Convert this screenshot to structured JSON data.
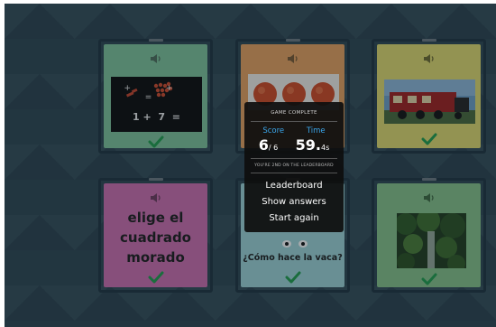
{
  "modal": {
    "title": "GAME COMPLETE",
    "score_label": "Score",
    "time_label": "Time",
    "score_value": "6",
    "score_total": "/ 6",
    "time_value": "59.",
    "time_decimal": "4s",
    "rank_text": "YOU'RE 2ND ON THE LEADERBOARD",
    "leaderboard_label": "Leaderboard",
    "show_answers_label": "Show answers",
    "start_again_label": "Start again"
  },
  "cards": {
    "math": {
      "line1_ops": "+ + =",
      "line2": "1 +  7  =",
      "color": "#7fc69c"
    },
    "apples": {
      "color": "#e8a25e"
    },
    "train": {
      "color": "#e2dc6e"
    },
    "spanish_text": {
      "lines": [
        "elige el",
        "cuadrado",
        "morado"
      ],
      "color": "#cf6fb0"
    },
    "cow": {
      "caption": "¿Cómo hace la vaca?",
      "color": "#9fd6d8"
    },
    "jungle": {
      "color": "#87c48a"
    }
  },
  "colors": {
    "check": "#1f9e4c",
    "accent_blue": "#3aa4e8"
  },
  "icons": {
    "speaker": "speaker-icon",
    "check": "checkmark-icon"
  }
}
